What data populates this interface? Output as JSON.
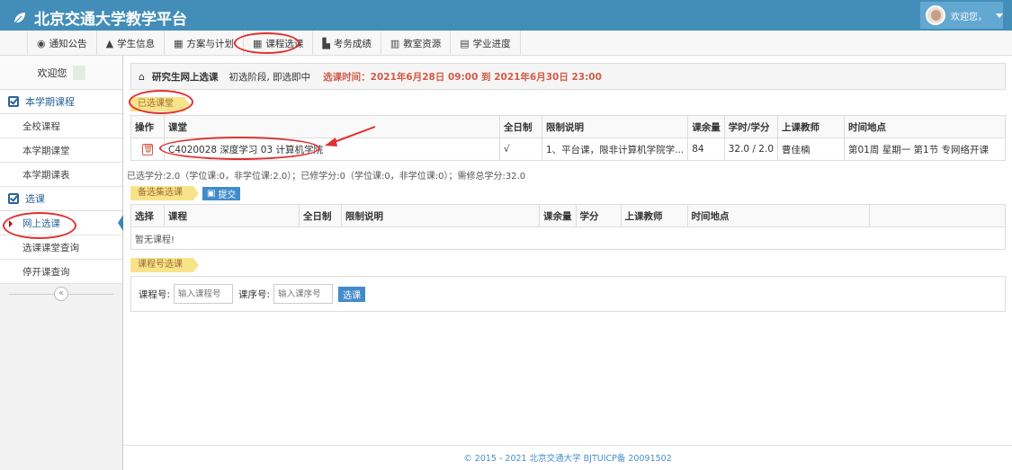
{
  "app": {
    "title": "北京交通大学教学平台"
  },
  "user": {
    "greeting": "欢迎您，"
  },
  "nav": {
    "items": [
      {
        "label": "通知公告",
        "icon": "globe-icon",
        "glyph": "◉"
      },
      {
        "label": "学生信息",
        "icon": "graduation-cap-icon",
        "glyph": "🎓"
      },
      {
        "label": "方案与计划",
        "icon": "calendar-icon",
        "glyph": "▦"
      },
      {
        "label": "课程选课",
        "icon": "calendar-icon",
        "glyph": "▦"
      },
      {
        "label": "考务成绩",
        "icon": "chart-icon",
        "glyph": "▙"
      },
      {
        "label": "教室资源",
        "icon": "bank-icon",
        "glyph": "▥"
      },
      {
        "label": "学业进度",
        "icon": "list-icon",
        "glyph": "▤"
      }
    ]
  },
  "sidebar": {
    "welcome": "欢迎您",
    "section1": "本学期课程",
    "section1_items": [
      "全校课程",
      "本学期课堂",
      "本学期课表"
    ],
    "section2": "选课",
    "section2_items": [
      "网上选课",
      "选课课堂查询",
      "停开课查询"
    ],
    "collapse": "«"
  },
  "main": {
    "crumb_title": "研究生网上选课",
    "stage": "初选阶段, 即选即中",
    "time": "选课时间：2021年6月28日 09:00 到 2021年6月30日 23:00",
    "selected_tag": "已选课堂",
    "selected_table": {
      "headers": [
        "操作",
        "课堂",
        "全日制",
        "限制说明",
        "课余量",
        "学时/学分",
        "上课教师",
        "时间地点"
      ],
      "rows": [
        [
          "",
          "C4020028 深度学习 03 计算机学院",
          "√",
          "1、平台课，限非计算机学院学...",
          "84",
          "32.0 / 2.0",
          "曹佳楠",
          "第01周 星期一 第1节 专网络开课"
        ]
      ]
    },
    "summary": "已选学分:2.0（学位课:0，非学位课:2.0）；已修学分:0（学位课:0，非学位课:0）；需修总学分:32.0",
    "backup_tag": "备选集选课",
    "submit_label": "提交",
    "backup_table": {
      "headers": [
        "选择",
        "课程",
        "全日制",
        "限制说明",
        "课余量",
        "学分",
        "上课教师",
        "时间地点",
        ""
      ],
      "empty": "暂无课程!"
    },
    "code_tag": "课程号选课",
    "form": {
      "course_label": "课程号:",
      "course_placeholder": "输入课程号",
      "seq_label": "课序号:",
      "seq_placeholder": "输入课序号",
      "button": "选课"
    }
  },
  "footer": "© 2015 - 2021 北京交通大学 BJTUICP备 20091502",
  "colors": {
    "header": "#438eb9",
    "accent": "#2a6496",
    "alert": "#d15b47",
    "annotation": "#e03030"
  }
}
